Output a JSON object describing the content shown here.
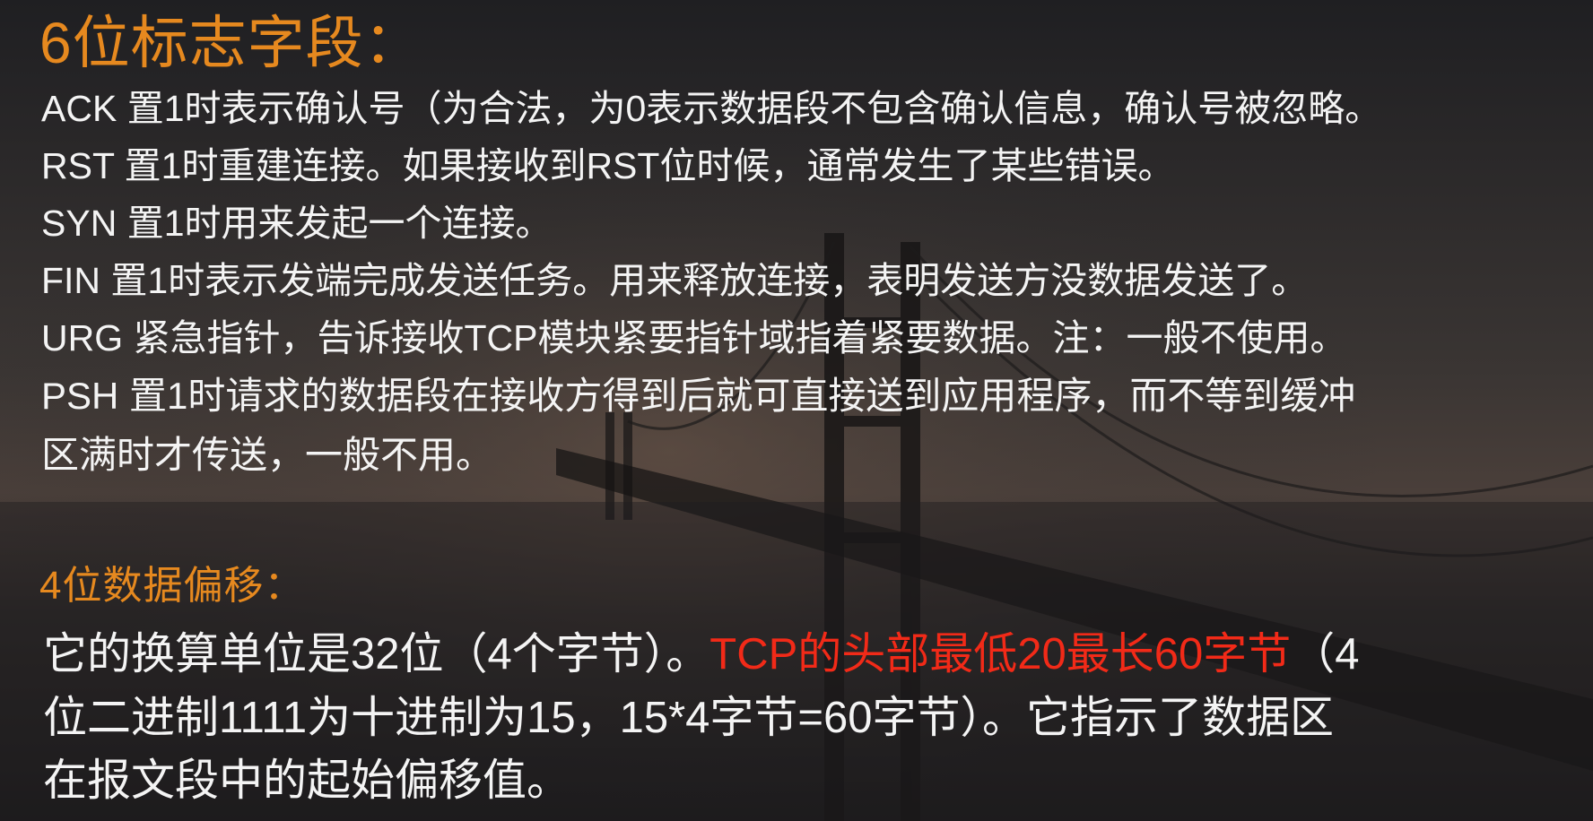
{
  "heading_flags": "6位标志字段：",
  "flags": [
    "ACK 置1时表示确认号（为合法，为0表示数据段不包含确认信息，确认号被忽略。",
    "RST 置1时重建连接。如果接收到RST位时候，通常发生了某些错误。",
    "SYN 置1时用来发起一个连接。",
    "FIN  置1时表示发端完成发送任务。用来释放连接，表明发送方没数据发送了。",
    "URG 紧急指针，告诉接收TCP模块紧要指针域指着紧要数据。注：一般不使用。",
    "PSH 置1时请求的数据段在接收方得到后就可直接送到应用程序，而不等到缓冲",
    "区满时才传送，一般不用。"
  ],
  "heading_offset": "4位数据偏移：",
  "offset_text": {
    "line1_before": "它的换算单位是32位（4个字节）。",
    "line1_highlight": "TCP的头部最低20最长60字节",
    "line1_after": "（4",
    "line2": "位二进制1111为十进制为15，15*4字节=60字节）。它指示了数据区",
    "line3": "在报文段中的起始偏移值。"
  },
  "colors": {
    "heading": "#e6891f",
    "body_text": "#f4f4f4",
    "highlight": "#f22a18",
    "background": "#2a2a2c"
  }
}
